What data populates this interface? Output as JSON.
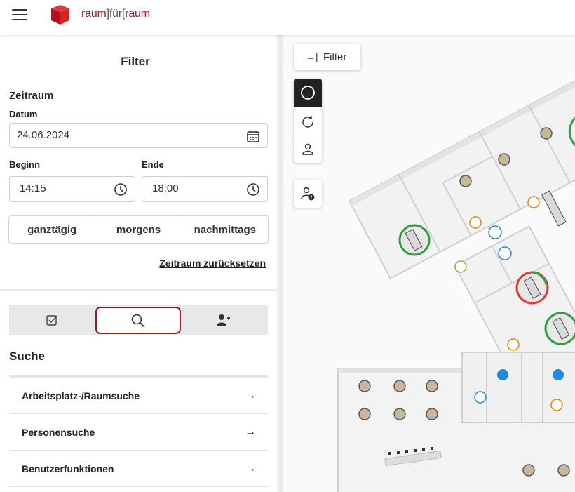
{
  "header": {
    "brand_left": "raum",
    "brand_mid": "]für[",
    "brand_right": "raum"
  },
  "filter": {
    "title": "Filter",
    "zeitraum": {
      "title": "Zeitraum",
      "datum_label": "Datum",
      "datum_value": "24.06.2024",
      "beginn_label": "Beginn",
      "beginn_value": "14:15",
      "ende_label": "Ende",
      "ende_value": "18:00",
      "presets": [
        "ganztägig",
        "morgens",
        "nachmittags"
      ],
      "reset_label": "Zeitraum zurücksetzen"
    }
  },
  "tabs": [
    {
      "icon": "checkbox-icon"
    },
    {
      "icon": "search-icon",
      "active": true
    },
    {
      "icon": "person-heart-icon"
    }
  ],
  "suche": {
    "title": "Suche",
    "items": [
      {
        "label": "Arbeitsplatz-/Raumsuche"
      },
      {
        "label": "Personensuche"
      },
      {
        "label": "Benutzerfunktionen"
      }
    ],
    "arrow": "→"
  },
  "map": {
    "filter_button": {
      "icon": "←|",
      "label": "Filter"
    },
    "accent_red": "#b5121b",
    "free_green": "#2ea043",
    "booked_red": "#e53935",
    "service_orange": "#f57c00",
    "info_blue": "#1e88e5"
  }
}
